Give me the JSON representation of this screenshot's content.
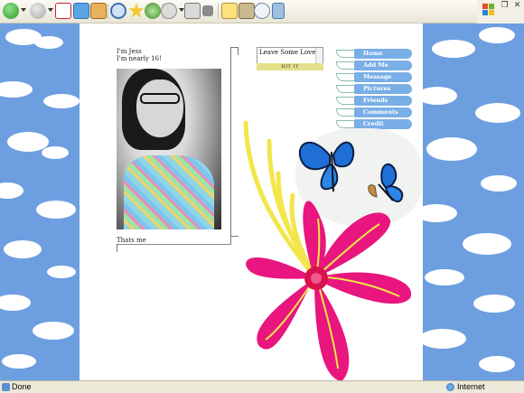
{
  "browser": {
    "status_text": "Done",
    "zone_text": "Internet",
    "toolbar_icons": [
      "back-icon",
      "forward-icon",
      "stop-icon",
      "refresh-icon",
      "home-icon",
      "search-icon",
      "favorites-icon",
      "media-icon",
      "history-icon",
      "mail-icon",
      "print-icon",
      "edit-icon",
      "discuss-icon",
      "research-icon",
      "messenger-icon",
      "bluetooth-icon"
    ]
  },
  "profile": {
    "intro_line1": "I'm Jess",
    "intro_line2": "I'm nearly 16!",
    "photo_caption": "Thats me"
  },
  "comment_box": {
    "text": "Leave Some Love",
    "button_label": "HIT IT"
  },
  "nav": {
    "items": [
      {
        "label": "Home"
      },
      {
        "label": "Add Me"
      },
      {
        "label": "Message"
      },
      {
        "label": "Pictures"
      },
      {
        "label": "Friends"
      },
      {
        "label": "Comments"
      },
      {
        "label": "Credit"
      }
    ]
  },
  "colors": {
    "sky": "#6d9ee0",
    "nav_tab": "#79aee6",
    "flower": "#e8167e",
    "stamen": "#f2e64a",
    "butterfly": "#1f6fd6"
  }
}
